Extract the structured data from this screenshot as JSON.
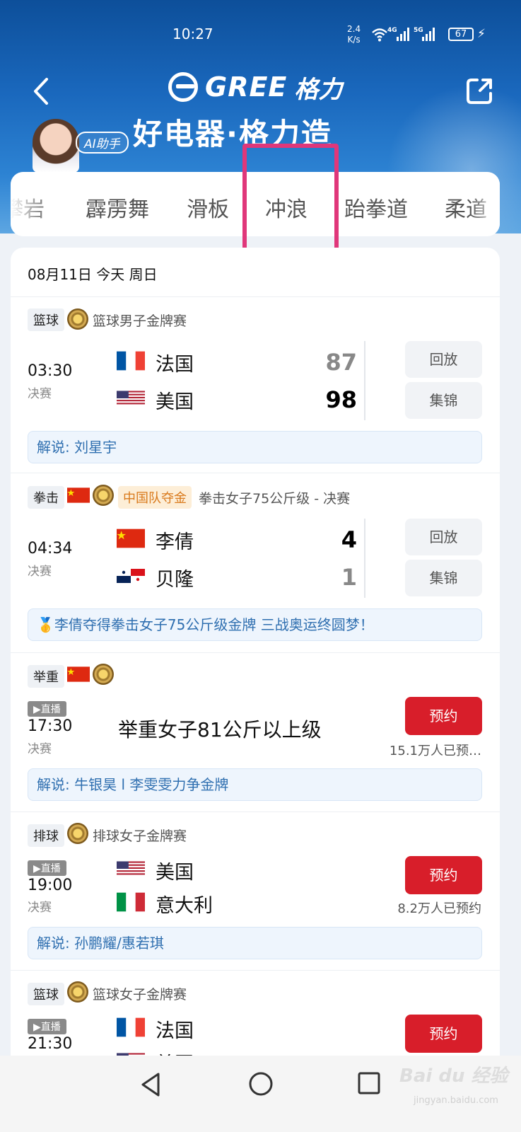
{
  "status": {
    "time": "10:27",
    "netspeed_value": "2.4",
    "netspeed_unit": "K/s",
    "net1": "4G",
    "net2": "5G",
    "battery": "67"
  },
  "header": {
    "logo_text": "GREE",
    "logo_cn": "格力",
    "slogan": "好电器·格力造",
    "ai_tag": "AI助手"
  },
  "tabs": [
    {
      "label": "攀岩"
    },
    {
      "label": "霹雳舞"
    },
    {
      "label": "滑板"
    },
    {
      "label": "冲浪",
      "highlighted": true
    },
    {
      "label": "跆拳道"
    },
    {
      "label": "柔道"
    }
  ],
  "date_header": "08月11日 今天 周日",
  "events": [
    {
      "sport": "篮球",
      "event_name": "篮球男子金牌赛",
      "time": "03:30",
      "stage": "决赛",
      "team1": {
        "name": "法国",
        "flag": "france-flag",
        "score": "87"
      },
      "team2": {
        "name": "美国",
        "flag": "usa-flag",
        "score": "98"
      },
      "buttons": [
        "回放",
        "集锦"
      ],
      "commentary": "解说: 刘星宇"
    },
    {
      "sport": "拳击",
      "badge": "中国队夺金",
      "event_name": "拳击女子75公斤级 - 决赛",
      "time": "04:34",
      "stage": "决赛",
      "team1": {
        "name": "李倩",
        "flag": "china-flag",
        "score": "4"
      },
      "team2": {
        "name": "贝隆",
        "flag": "panama-flag",
        "score": "1"
      },
      "buttons": [
        "回放",
        "集锦"
      ],
      "commentary": "🥇李倩夺得拳击女子75公斤级金牌 三战奥运终圆梦！"
    },
    {
      "sport": "举重",
      "live": "▶直播",
      "time": "17:30",
      "stage": "决赛",
      "title": "举重女子81公斤以上级",
      "button": "预约",
      "count": "15.1万人已预…",
      "commentary": "解说: 牛银昊 l 李雯雯力争金牌"
    },
    {
      "sport": "排球",
      "event_name": "排球女子金牌赛",
      "live": "▶直播",
      "time": "19:00",
      "stage": "决赛",
      "team1": {
        "name": "美国",
        "flag": "usa-flag"
      },
      "team2": {
        "name": "意大利",
        "flag": "italy-flag"
      },
      "button": "预约",
      "count": "8.2万人已预约",
      "commentary": "解说: 孙鹏耀/惠若琪"
    },
    {
      "sport": "篮球",
      "event_name": "篮球女子金牌赛",
      "live": "▶直播",
      "time": "21:30",
      "team1": {
        "name": "法国",
        "flag": "france-flag"
      },
      "team2": {
        "name": "美国",
        "flag": "usa-flag"
      },
      "button": "预约"
    }
  ],
  "watermark": {
    "text": "Bai du 经验",
    "sub": "jingyan.baidu.com"
  },
  "colors": {
    "accent_red": "#d81e2a",
    "header_blue": "#1a68bd",
    "highlight_pink": "#e0377a"
  }
}
